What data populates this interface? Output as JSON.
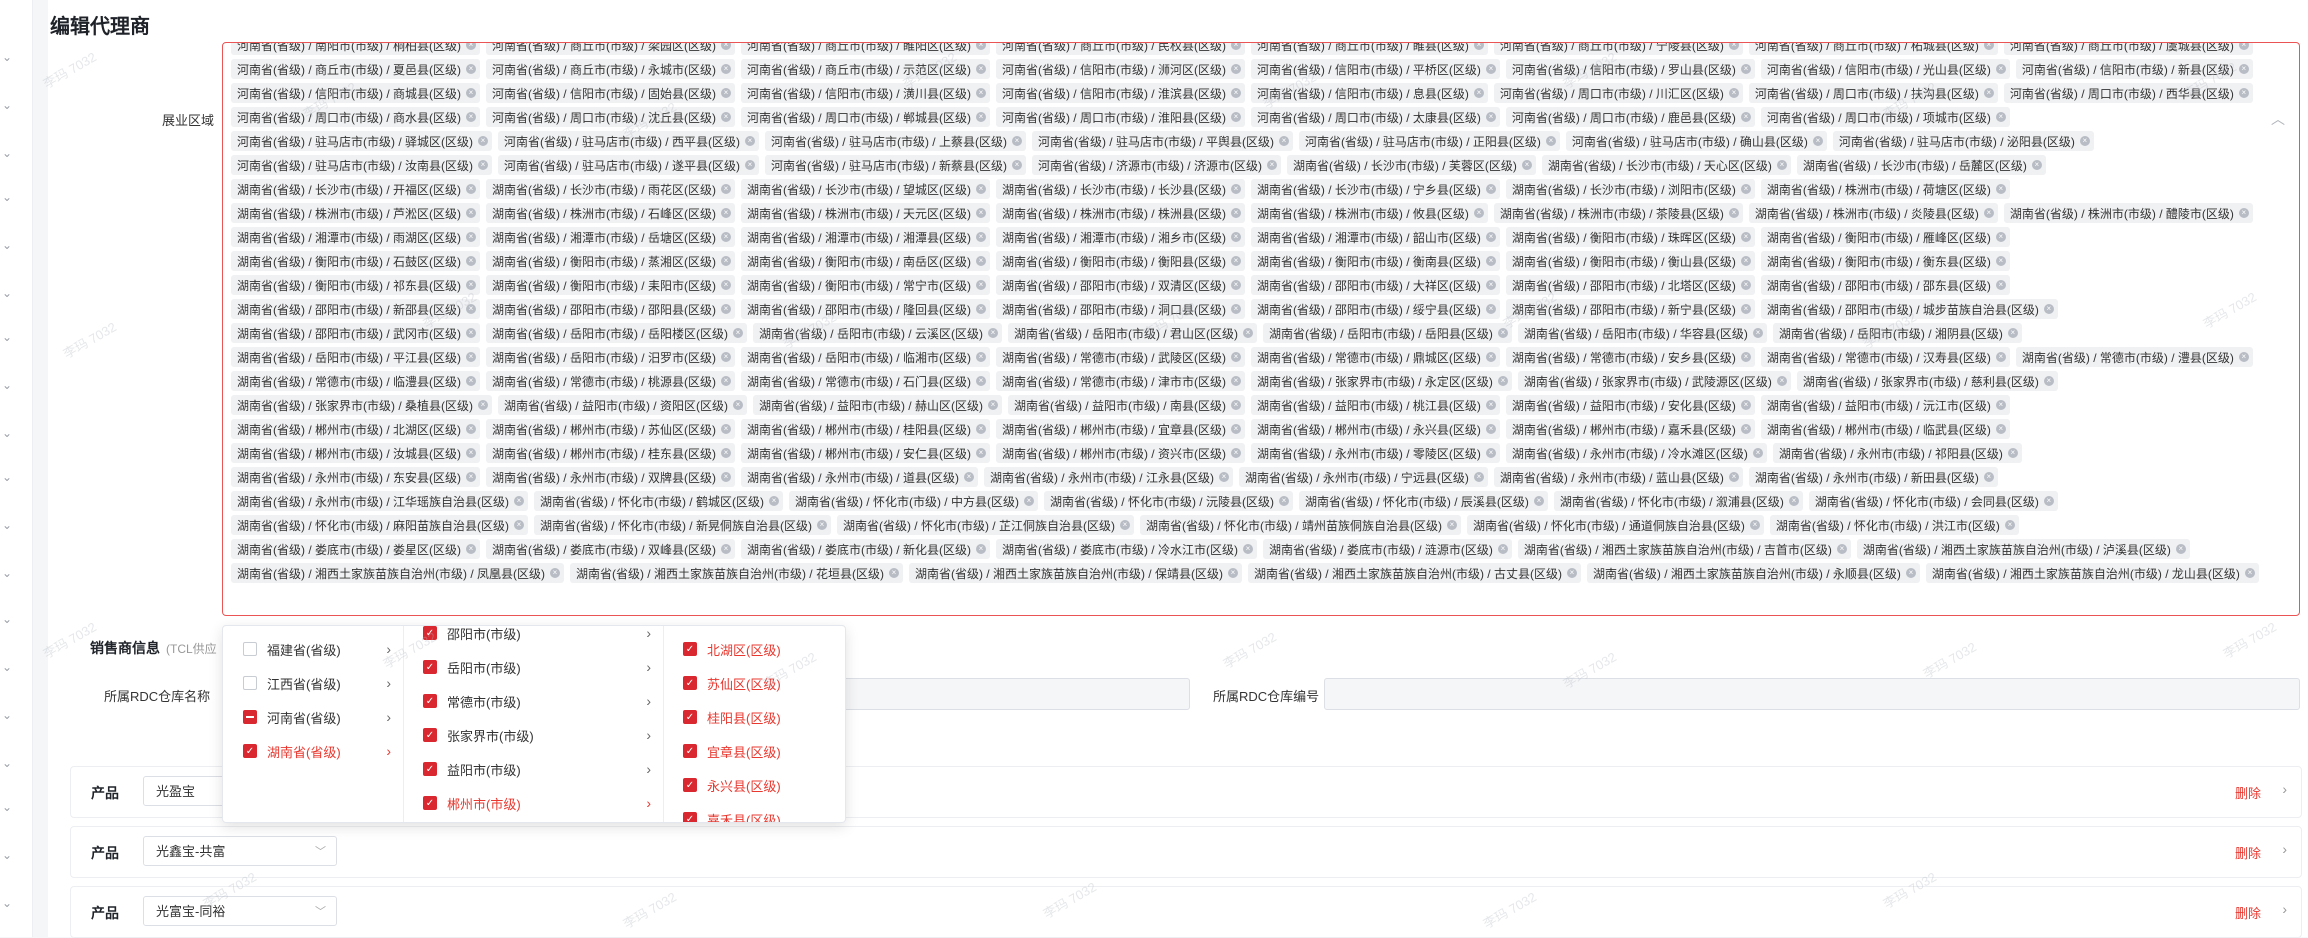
{
  "page": {
    "title": "编辑代理商"
  },
  "region": {
    "label": "展业区域",
    "tags": [
      "河南省(省级) / 南阳市(市级) / 桐柏县(区级)",
      "河南省(省级) / 商丘市(市级) / 梁园区(区级)",
      "河南省(省级) / 商丘市(市级) / 睢阳区(区级)",
      "河南省(省级) / 商丘市(市级) / 民权县(区级)",
      "河南省(省级) / 商丘市(市级) / 睢县(区级)",
      "河南省(省级) / 商丘市(市级) / 宁陵县(区级)",
      "河南省(省级) / 商丘市(市级) / 柘城县(区级)",
      "河南省(省级) / 商丘市(市级) / 虞城县(区级)",
      "河南省(省级) / 商丘市(市级) / 夏邑县(区级)",
      "河南省(省级) / 商丘市(市级) / 永城市(区级)",
      "河南省(省级) / 商丘市(市级) / 示范区(区级)",
      "河南省(省级) / 信阳市(市级) / 浉河区(区级)",
      "河南省(省级) / 信阳市(市级) / 平桥区(区级)",
      "河南省(省级) / 信阳市(市级) / 罗山县(区级)",
      "河南省(省级) / 信阳市(市级) / 光山县(区级)",
      "河南省(省级) / 信阳市(市级) / 新县(区级)",
      "河南省(省级) / 信阳市(市级) / 商城县(区级)",
      "河南省(省级) / 信阳市(市级) / 固始县(区级)",
      "河南省(省级) / 信阳市(市级) / 潢川县(区级)",
      "河南省(省级) / 信阳市(市级) / 淮滨县(区级)",
      "河南省(省级) / 信阳市(市级) / 息县(区级)",
      "河南省(省级) / 周口市(市级) / 川汇区(区级)",
      "河南省(省级) / 周口市(市级) / 扶沟县(区级)",
      "河南省(省级) / 周口市(市级) / 西华县(区级)",
      "河南省(省级) / 周口市(市级) / 商水县(区级)",
      "河南省(省级) / 周口市(市级) / 沈丘县(区级)",
      "河南省(省级) / 周口市(市级) / 郸城县(区级)",
      "河南省(省级) / 周口市(市级) / 淮阳县(区级)",
      "河南省(省级) / 周口市(市级) / 太康县(区级)",
      "河南省(省级) / 周口市(市级) / 鹿邑县(区级)",
      "河南省(省级) / 周口市(市级) / 项城市(区级)",
      "河南省(省级) / 驻马店市(市级) / 驿城区(区级)",
      "河南省(省级) / 驻马店市(市级) / 西平县(区级)",
      "河南省(省级) / 驻马店市(市级) / 上蔡县(区级)",
      "河南省(省级) / 驻马店市(市级) / 平舆县(区级)",
      "河南省(省级) / 驻马店市(市级) / 正阳县(区级)",
      "河南省(省级) / 驻马店市(市级) / 确山县(区级)",
      "河南省(省级) / 驻马店市(市级) / 泌阳县(区级)",
      "河南省(省级) / 驻马店市(市级) / 汝南县(区级)",
      "河南省(省级) / 驻马店市(市级) / 遂平县(区级)",
      "河南省(省级) / 驻马店市(市级) / 新蔡县(区级)",
      "河南省(省级) / 济源市(市级) / 济源市(区级)",
      "湖南省(省级) / 长沙市(市级) / 芙蓉区(区级)",
      "湖南省(省级) / 长沙市(市级) / 天心区(区级)",
      "湖南省(省级) / 长沙市(市级) / 岳麓区(区级)",
      "湖南省(省级) / 长沙市(市级) / 开福区(区级)",
      "湖南省(省级) / 长沙市(市级) / 雨花区(区级)",
      "湖南省(省级) / 长沙市(市级) / 望城区(区级)",
      "湖南省(省级) / 长沙市(市级) / 长沙县(区级)",
      "湖南省(省级) / 长沙市(市级) / 宁乡县(区级)",
      "湖南省(省级) / 长沙市(市级) / 浏阳市(区级)",
      "湖南省(省级) / 株洲市(市级) / 荷塘区(区级)",
      "湖南省(省级) / 株洲市(市级) / 芦淞区(区级)",
      "湖南省(省级) / 株洲市(市级) / 石峰区(区级)",
      "湖南省(省级) / 株洲市(市级) / 天元区(区级)",
      "湖南省(省级) / 株洲市(市级) / 株洲县(区级)",
      "湖南省(省级) / 株洲市(市级) / 攸县(区级)",
      "湖南省(省级) / 株洲市(市级) / 茶陵县(区级)",
      "湖南省(省级) / 株洲市(市级) / 炎陵县(区级)",
      "湖南省(省级) / 株洲市(市级) / 醴陵市(区级)",
      "湖南省(省级) / 湘潭市(市级) / 雨湖区(区级)",
      "湖南省(省级) / 湘潭市(市级) / 岳塘区(区级)",
      "湖南省(省级) / 湘潭市(市级) / 湘潭县(区级)",
      "湖南省(省级) / 湘潭市(市级) / 湘乡市(区级)",
      "湖南省(省级) / 湘潭市(市级) / 韶山市(区级)",
      "湖南省(省级) / 衡阳市(市级) / 珠晖区(区级)",
      "湖南省(省级) / 衡阳市(市级) / 雁峰区(区级)",
      "湖南省(省级) / 衡阳市(市级) / 石鼓区(区级)",
      "湖南省(省级) / 衡阳市(市级) / 蒸湘区(区级)",
      "湖南省(省级) / 衡阳市(市级) / 南岳区(区级)",
      "湖南省(省级) / 衡阳市(市级) / 衡阳县(区级)",
      "湖南省(省级) / 衡阳市(市级) / 衡南县(区级)",
      "湖南省(省级) / 衡阳市(市级) / 衡山县(区级)",
      "湖南省(省级) / 衡阳市(市级) / 衡东县(区级)",
      "湖南省(省级) / 衡阳市(市级) / 祁东县(区级)",
      "湖南省(省级) / 衡阳市(市级) / 耒阳市(区级)",
      "湖南省(省级) / 衡阳市(市级) / 常宁市(区级)",
      "湖南省(省级) / 邵阳市(市级) / 双清区(区级)",
      "湖南省(省级) / 邵阳市(市级) / 大祥区(区级)",
      "湖南省(省级) / 邵阳市(市级) / 北塔区(区级)",
      "湖南省(省级) / 邵阳市(市级) / 邵东县(区级)",
      "湖南省(省级) / 邵阳市(市级) / 新邵县(区级)",
      "湖南省(省级) / 邵阳市(市级) / 邵阳县(区级)",
      "湖南省(省级) / 邵阳市(市级) / 隆回县(区级)",
      "湖南省(省级) / 邵阳市(市级) / 洞口县(区级)",
      "湖南省(省级) / 邵阳市(市级) / 绥宁县(区级)",
      "湖南省(省级) / 邵阳市(市级) / 新宁县(区级)",
      "湖南省(省级) / 邵阳市(市级) / 城步苗族自治县(区级)",
      "湖南省(省级) / 邵阳市(市级) / 武冈市(区级)",
      "湖南省(省级) / 岳阳市(市级) / 岳阳楼区(区级)",
      "湖南省(省级) / 岳阳市(市级) / 云溪区(区级)",
      "湖南省(省级) / 岳阳市(市级) / 君山区(区级)",
      "湖南省(省级) / 岳阳市(市级) / 岳阳县(区级)",
      "湖南省(省级) / 岳阳市(市级) / 华容县(区级)",
      "湖南省(省级) / 岳阳市(市级) / 湘阴县(区级)",
      "湖南省(省级) / 岳阳市(市级) / 平江县(区级)",
      "湖南省(省级) / 岳阳市(市级) / 汨罗市(区级)",
      "湖南省(省级) / 岳阳市(市级) / 临湘市(区级)",
      "湖南省(省级) / 常德市(市级) / 武陵区(区级)",
      "湖南省(省级) / 常德市(市级) / 鼎城区(区级)",
      "湖南省(省级) / 常德市(市级) / 安乡县(区级)",
      "湖南省(省级) / 常德市(市级) / 汉寿县(区级)",
      "湖南省(省级) / 常德市(市级) / 澧县(区级)",
      "湖南省(省级) / 常德市(市级) / 临澧县(区级)",
      "湖南省(省级) / 常德市(市级) / 桃源县(区级)",
      "湖南省(省级) / 常德市(市级) / 石门县(区级)",
      "湖南省(省级) / 常德市(市级) / 津市市(区级)",
      "湖南省(省级) / 张家界市(市级) / 永定区(区级)",
      "湖南省(省级) / 张家界市(市级) / 武陵源区(区级)",
      "湖南省(省级) / 张家界市(市级) / 慈利县(区级)",
      "湖南省(省级) / 张家界市(市级) / 桑植县(区级)",
      "湖南省(省级) / 益阳市(市级) / 资阳区(区级)",
      "湖南省(省级) / 益阳市(市级) / 赫山区(区级)",
      "湖南省(省级) / 益阳市(市级) / 南县(区级)",
      "湖南省(省级) / 益阳市(市级) / 桃江县(区级)",
      "湖南省(省级) / 益阳市(市级) / 安化县(区级)",
      "湖南省(省级) / 益阳市(市级) / 沅江市(区级)",
      "湖南省(省级) / 郴州市(市级) / 北湖区(区级)",
      "湖南省(省级) / 郴州市(市级) / 苏仙区(区级)",
      "湖南省(省级) / 郴州市(市级) / 桂阳县(区级)",
      "湖南省(省级) / 郴州市(市级) / 宜章县(区级)",
      "湖南省(省级) / 郴州市(市级) / 永兴县(区级)",
      "湖南省(省级) / 郴州市(市级) / 嘉禾县(区级)",
      "湖南省(省级) / 郴州市(市级) / 临武县(区级)",
      "湖南省(省级) / 郴州市(市级) / 汝城县(区级)",
      "湖南省(省级) / 郴州市(市级) / 桂东县(区级)",
      "湖南省(省级) / 郴州市(市级) / 安仁县(区级)",
      "湖南省(省级) / 郴州市(市级) / 资兴市(区级)",
      "湖南省(省级) / 永州市(市级) / 零陵区(区级)",
      "湖南省(省级) / 永州市(市级) / 冷水滩区(区级)",
      "湖南省(省级) / 永州市(市级) / 祁阳县(区级)",
      "湖南省(省级) / 永州市(市级) / 东安县(区级)",
      "湖南省(省级) / 永州市(市级) / 双牌县(区级)",
      "湖南省(省级) / 永州市(市级) / 道县(区级)",
      "湖南省(省级) / 永州市(市级) / 江永县(区级)",
      "湖南省(省级) / 永州市(市级) / 宁远县(区级)",
      "湖南省(省级) / 永州市(市级) / 蓝山县(区级)",
      "湖南省(省级) / 永州市(市级) / 新田县(区级)",
      "湖南省(省级) / 永州市(市级) / 江华瑶族自治县(区级)",
      "湖南省(省级) / 怀化市(市级) / 鹤城区(区级)",
      "湖南省(省级) / 怀化市(市级) / 中方县(区级)",
      "湖南省(省级) / 怀化市(市级) / 沅陵县(区级)",
      "湖南省(省级) / 怀化市(市级) / 辰溪县(区级)",
      "湖南省(省级) / 怀化市(市级) / 溆浦县(区级)",
      "湖南省(省级) / 怀化市(市级) / 会同县(区级)",
      "湖南省(省级) / 怀化市(市级) / 麻阳苗族自治县(区级)",
      "湖南省(省级) / 怀化市(市级) / 新晃侗族自治县(区级)",
      "湖南省(省级) / 怀化市(市级) / 芷江侗族自治县(区级)",
      "湖南省(省级) / 怀化市(市级) / 靖州苗族侗族自治县(区级)",
      "湖南省(省级) / 怀化市(市级) / 通道侗族自治县(区级)",
      "湖南省(省级) / 怀化市(市级) / 洪江市(区级)",
      "湖南省(省级) / 娄底市(市级) / 娄星区(区级)",
      "湖南省(省级) / 娄底市(市级) / 双峰县(区级)",
      "湖南省(省级) / 娄底市(市级) / 新化县(区级)",
      "湖南省(省级) / 娄底市(市级) / 冷水江市(区级)",
      "湖南省(省级) / 娄底市(市级) / 涟源市(区级)",
      "湖南省(省级) / 湘西土家族苗族自治州(市级) / 吉首市(区级)",
      "湖南省(省级) / 湘西土家族苗族自治州(市级) / 泸溪县(区级)",
      "湖南省(省级) / 湘西土家族苗族自治州(市级) / 凤凰县(区级)",
      "湖南省(省级) / 湘西土家族苗族自治州(市级) / 花垣县(区级)",
      "湖南省(省级) / 湘西土家族苗族自治州(市级) / 保靖县(区级)",
      "湖南省(省级) / 湘西土家族苗族自治州(市级) / 古丈县(区级)",
      "湖南省(省级) / 湘西土家族苗族自治州(市级) / 永顺县(区级)",
      "湖南省(省级) / 湘西土家族苗族自治州(市级) / 龙山县(区级)"
    ]
  },
  "dealer": {
    "title": "销售商信息",
    "subtitle": "(TCL供应",
    "rdc_name_label": "所属RDC仓库名称",
    "rdc_code_label": "所属RDC仓库编号"
  },
  "products": [
    {
      "label": "产品",
      "value": "光盈宝",
      "delete": "删除"
    },
    {
      "label": "产品",
      "value": "光鑫宝-共富",
      "delete": "删除"
    },
    {
      "label": "产品",
      "value": "光富宝-同裕",
      "delete": "删除"
    }
  ],
  "cascader": {
    "provinces": [
      {
        "label": "福建省(省级)",
        "state": "unchecked",
        "active": false
      },
      {
        "label": "江西省(省级)",
        "state": "unchecked",
        "active": false
      },
      {
        "label": "河南省(省级)",
        "state": "half",
        "active": false
      },
      {
        "label": "湖南省(省级)",
        "state": "checked",
        "active": true
      }
    ],
    "cities": [
      {
        "label": "邵阳市(市级)",
        "active": false
      },
      {
        "label": "岳阳市(市级)",
        "active": false
      },
      {
        "label": "常德市(市级)",
        "active": false
      },
      {
        "label": "张家界市(市级)",
        "active": false
      },
      {
        "label": "益阳市(市级)",
        "active": false
      },
      {
        "label": "郴州市(市级)",
        "active": true
      }
    ],
    "districts": [
      {
        "label": "北湖区(区级)"
      },
      {
        "label": "苏仙区(区级)"
      },
      {
        "label": "桂阳县(区级)"
      },
      {
        "label": "宜章县(区级)"
      },
      {
        "label": "永兴县(区级)"
      },
      {
        "label": "嘉禾县(区级)"
      }
    ]
  },
  "watermark": "李玛 7032",
  "colors": {
    "accent": "#e8382f",
    "tag_bg": "#f0f1f3"
  }
}
